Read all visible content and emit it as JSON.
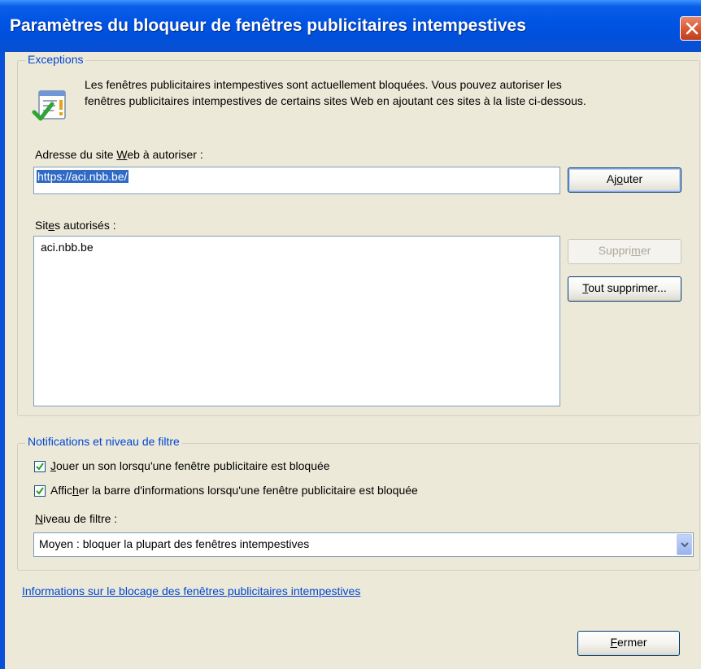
{
  "window": {
    "title": "Paramètres du bloqueur de fenêtres publicitaires intempestives",
    "close_icon": "close-icon"
  },
  "exceptions": {
    "legend": "Exceptions",
    "info_icon": "popup-allowed-icon",
    "info_line1": "Les fenêtres publicitaires intempestives sont actuellement bloquées.  Vous pouvez autoriser les",
    "info_line2": "fenêtres publicitaires intempestives de certains sites Web en ajoutant ces sites à la liste ci-dessous.",
    "address_label_pre": "Adresse du site ",
    "address_label_key": "W",
    "address_label_post": "eb à autoriser :",
    "address_value": "https://aci.nbb.be/",
    "add_button_pre": "Aj",
    "add_button_key": "o",
    "add_button_post": "uter",
    "sites_label_pre": "Sit",
    "sites_label_key": "e",
    "sites_label_post": "s autorisés :",
    "sites": [
      "aci.nbb.be"
    ],
    "remove_button_pre": "Suppri",
    "remove_button_key": "m",
    "remove_button_post": "er",
    "remove_all_button_key": "T",
    "remove_all_button_post": "out supprimer..."
  },
  "notifications": {
    "legend": "Notifications et niveau de filtre",
    "sound_checked": true,
    "sound_label_key": "J",
    "sound_label_post": "ouer un son lorsqu'une fenêtre publicitaire est bloquée",
    "infobar_checked": true,
    "infobar_label_pre": "Affic",
    "infobar_label_key": "h",
    "infobar_label_post": "er la barre d'informations lorsqu'une fenêtre publicitaire est bloquée",
    "filter_label_key": "N",
    "filter_label_post": "iveau de filtre :",
    "filter_value": "Moyen : bloquer la plupart des fenêtres intempestives"
  },
  "footer": {
    "link": "Informations sur le blocage des fenêtres publicitaires intempestives",
    "close_button_key": "F",
    "close_button_post": "ermer"
  },
  "colors": {
    "titlebar": "#0054e3",
    "dialog_bg": "#ece9d8",
    "legend_text": "#0046d5",
    "selection": "#316ac5"
  }
}
